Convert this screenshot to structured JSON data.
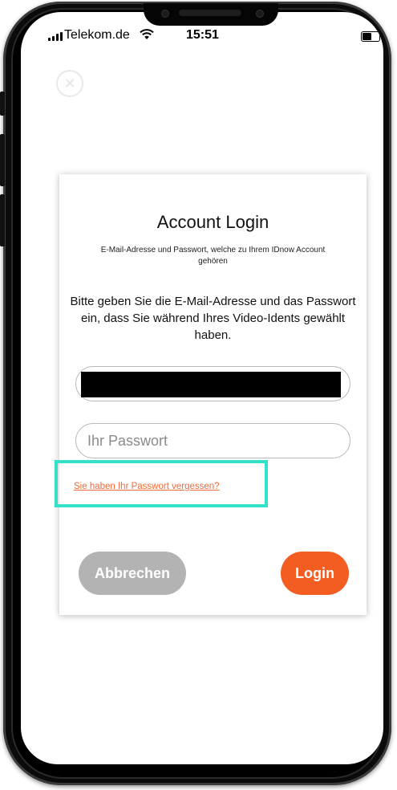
{
  "status_bar": {
    "carrier": "Telekom.de",
    "time": "15:51",
    "icons": [
      "signal-icon",
      "wifi-icon",
      "battery-icon"
    ]
  },
  "close_button": {
    "icon": "close-icon",
    "glyph": "✕"
  },
  "login_dialog": {
    "title": "Account Login",
    "subtitle": "E-Mail-Adresse und Passwort, welche zu Ihrem IDnow Account gehören",
    "description": "Bitte geben Sie die E-Mail-Adresse und das Passwort ein, dass Sie während Ihres Video-Idents gewählt haben.",
    "password_placeholder": "Ihr Passwort",
    "forgot_password_link": "Sie haben Ihr Passwort vergessen?",
    "cancel_button": "Abbrechen",
    "login_button": "Login"
  },
  "colors": {
    "accent": "#f35d22",
    "link": "#f06a36",
    "cancel_button": "#b3b3b3",
    "highlight_box": "#33e0c8"
  }
}
